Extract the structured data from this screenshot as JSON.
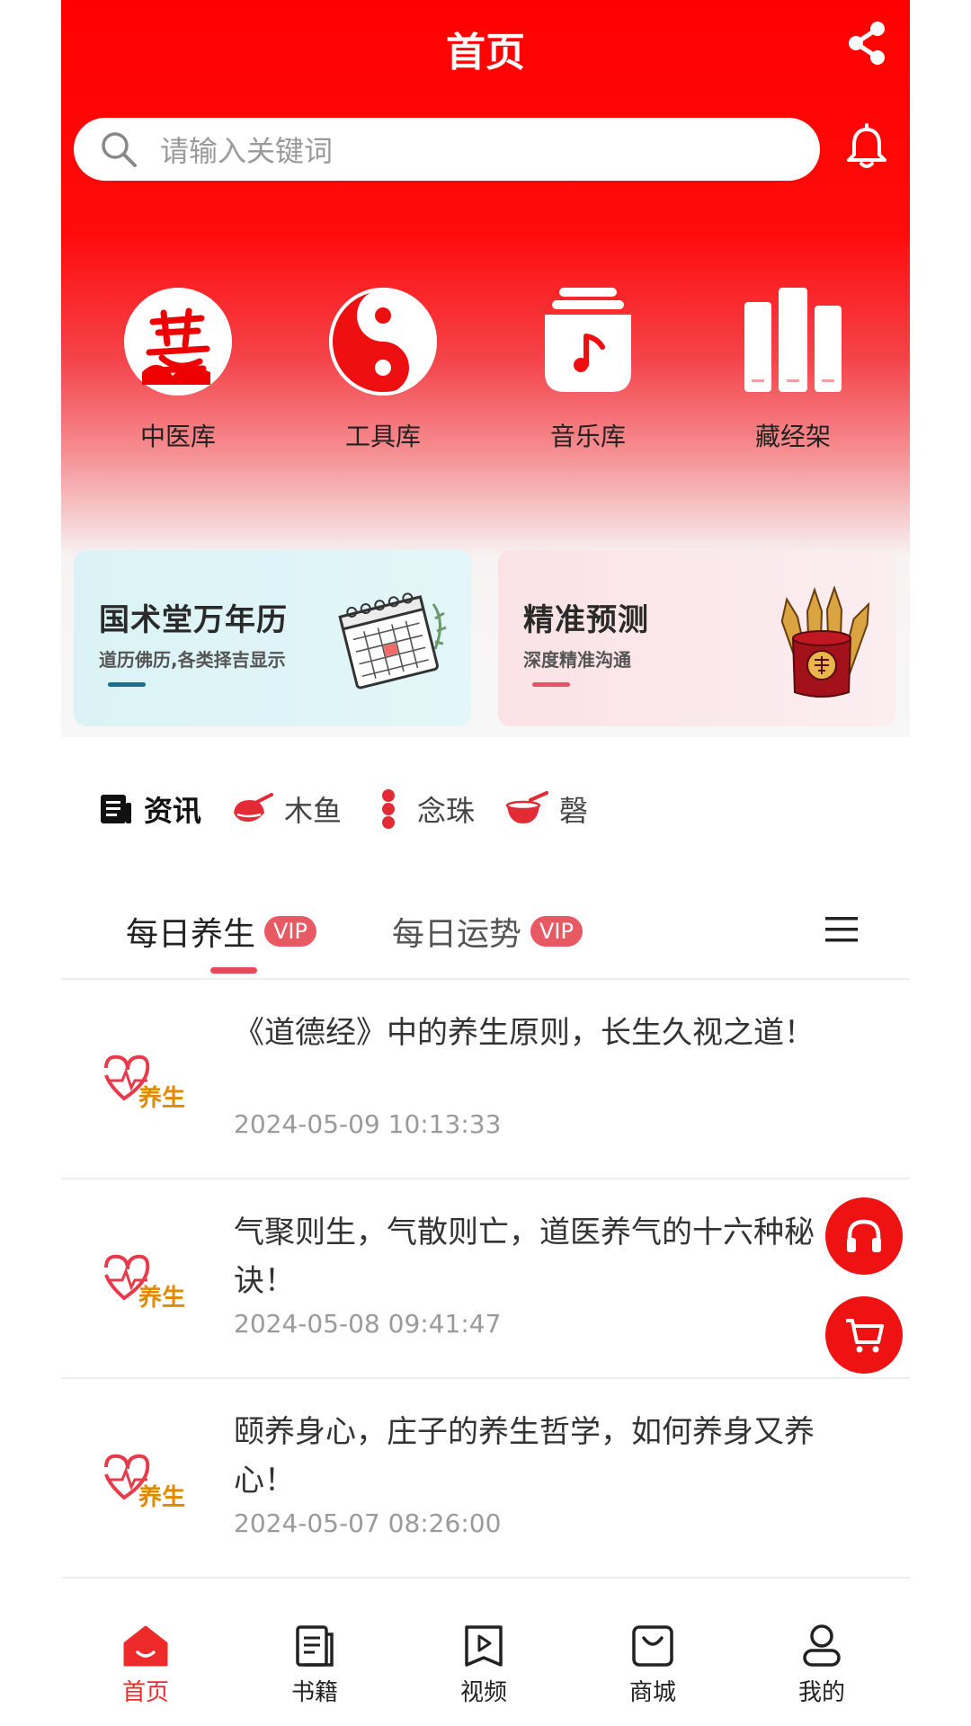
{
  "header": {
    "title": "首页"
  },
  "search": {
    "placeholder": "请输入关键词"
  },
  "quick_links": [
    {
      "label": "中医库",
      "icon": "yi-calligraphy-icon"
    },
    {
      "label": "工具库",
      "icon": "yin-yang-icon"
    },
    {
      "label": "音乐库",
      "icon": "music-jar-icon"
    },
    {
      "label": "藏经架",
      "icon": "bookshelf-icon"
    }
  ],
  "banners": [
    {
      "title": "国术堂万年历",
      "subtitle": "道历佛历,各类择吉显示",
      "icon": "calendar-icon"
    },
    {
      "title": "精准预测",
      "subtitle": "深度精准沟通",
      "icon": "fortune-sticks-icon"
    }
  ],
  "sub_nav": [
    {
      "label": "资讯",
      "icon": "news-icon",
      "active": true
    },
    {
      "label": "木鱼",
      "icon": "wooden-fish-icon"
    },
    {
      "label": "念珠",
      "icon": "prayer-beads-icon"
    },
    {
      "label": "磬",
      "icon": "chime-bowl-icon"
    }
  ],
  "tabs": [
    {
      "label": "每日养生",
      "badge": "VIP",
      "active": true
    },
    {
      "label": "每日运势",
      "badge": "VIP"
    }
  ],
  "news": [
    {
      "title": "《道德经》中的养生原则，长生久视之道！",
      "date": "2024-05-09 10:13:33",
      "logo_text": "养生"
    },
    {
      "title": "气聚则生，气散则亡，道医养气的十六种秘诀！",
      "date": "2024-05-08 09:41:47",
      "logo_text": "养生"
    },
    {
      "title": "颐养身心，庄子的养生哲学，如何养身又养心！",
      "date": "2024-05-07 08:26:00",
      "logo_text": "养生"
    }
  ],
  "bottom_nav": [
    {
      "label": "首页",
      "icon": "home-icon",
      "active": true
    },
    {
      "label": "书籍",
      "icon": "book-icon"
    },
    {
      "label": "视频",
      "icon": "video-icon"
    },
    {
      "label": "商城",
      "icon": "shopping-bag-icon"
    },
    {
      "label": "我的",
      "icon": "user-icon"
    }
  ],
  "colors": {
    "primary": "#ff0000",
    "accent": "#e9485b",
    "vip": "#e85a63",
    "nav_active": "#ee2a2a"
  }
}
